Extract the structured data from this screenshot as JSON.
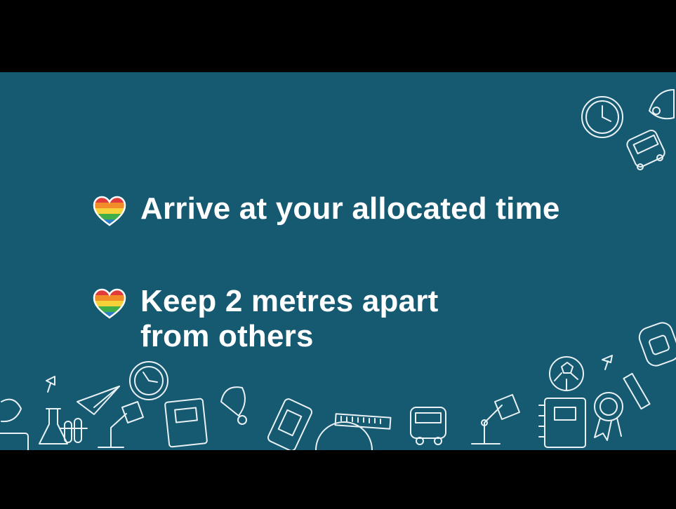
{
  "bullets": [
    {
      "text": "Arrive at your allocated time",
      "icon": "rainbow-heart-icon"
    },
    {
      "text": "Keep 2 metres apart\nfrom others",
      "icon": "rainbow-heart-icon"
    }
  ],
  "colors": {
    "background": "#165a72",
    "letterbox": "#000000",
    "text": "#ffffff",
    "doodle_stroke": "#e9f1f4",
    "heart_stripes": [
      "#e23b3b",
      "#f28c28",
      "#f6d23a",
      "#3fae49",
      "#2d7ec2"
    ]
  }
}
